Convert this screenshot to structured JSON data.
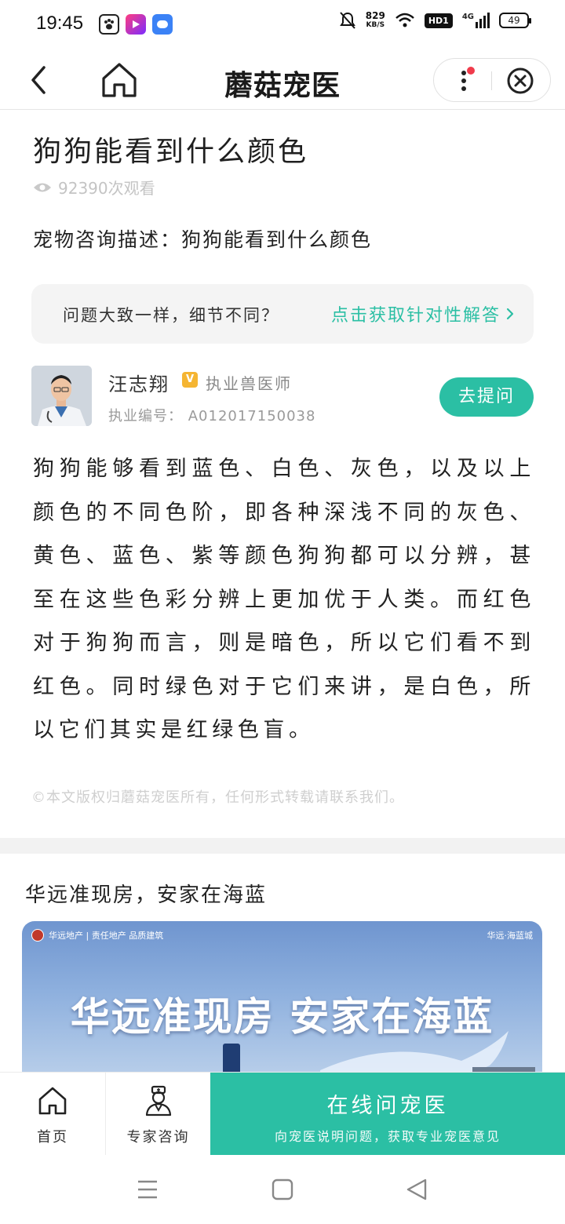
{
  "status_bar": {
    "time": "19:45",
    "speed_value": "829",
    "speed_unit": "KB/S",
    "hd_label": "HD1",
    "network": "4G",
    "battery": "49",
    "icons": [
      "baidu-paw-icon",
      "video-app-icon",
      "chat-app-icon",
      "mute-bell-icon",
      "wifi-icon",
      "signal-icon"
    ]
  },
  "header": {
    "title": "蘑菇宠医",
    "back_icon": "chevron-left-icon",
    "home_icon": "home-icon",
    "more_icon": "more-vertical-icon",
    "close_icon": "close-circle-icon",
    "notification_dot_color": "#f03b4b"
  },
  "question": {
    "title": "狗狗能看到什么颜色",
    "views": "92390次观看",
    "description": "宠物咨询描述：狗狗能看到什么颜色"
  },
  "tip": {
    "left_text": "问题大致一样，细节不同？",
    "right_text": "点击获取针对性解答"
  },
  "doctor": {
    "name": "汪志翔",
    "badge": "V",
    "role": "执业兽医师",
    "license": "执业编号： A012017150038",
    "ask_button": "去提问"
  },
  "answer": {
    "text": "狗狗能够看到蓝色、白色、灰色，以及以上颜色的不同色阶，即各种深浅不同的灰色、黄色、蓝色、紫等颜色狗狗都可以分辨，甚至在这些色彩分辨上更加优于人类。而红色对于狗狗而言，则是暗色，所以它们看不到红色。同时绿色对于它们来讲，是白色，所以它们其实是红绿色盲。",
    "copyright": "©本文版权归蘑菇宠医所有，任何形式转载请联系我们。"
  },
  "ad": {
    "title": "华远准现房，安家在海蓝",
    "brand_left": "华远地产 | 责任地产 品质建筑",
    "brand_right": "华远·海蓝城",
    "headline": "华远准现房 安家在海蓝"
  },
  "bottom_bar": {
    "home_label": "首页",
    "expert_label": "专家咨询",
    "cta_main": "在线问宠医",
    "cta_sub": "向宠医说明问题，获取专业宠医意见"
  },
  "colors": {
    "accent": "#2bbfa4",
    "badge": "#f5b532"
  }
}
